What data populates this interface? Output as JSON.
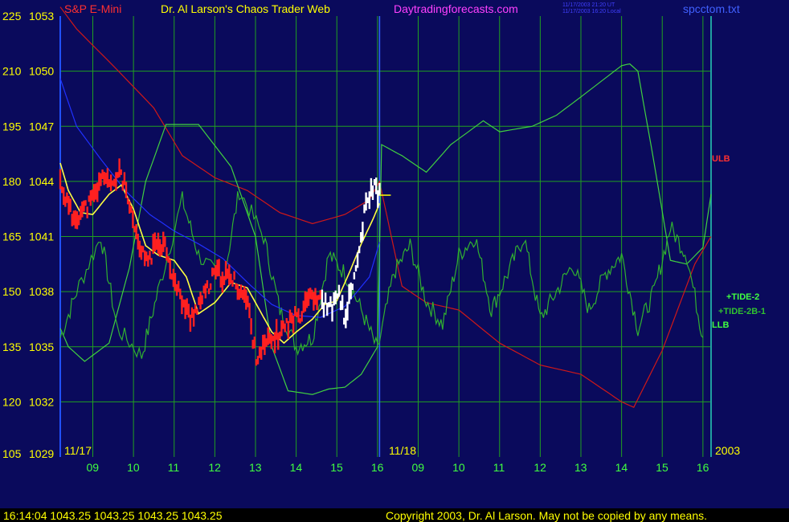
{
  "header": {
    "title": "S&P E-Mini",
    "subtitle": "Dr. Al Larson's Chaos Trader Web",
    "website": "Daytradingforecasts.com",
    "timestamp_ut": "11/17/2003 21:20 UT",
    "timestamp_local": "11/17/2003 16:20 Local",
    "filename": "spcctom.txt"
  },
  "footer": {
    "readout": "16:14:04  1043.25  1043.25  1043.25  1043.25",
    "copyright": "Copyright 2003, Dr. Al Larson. May not be copied by any means."
  },
  "colors": {
    "background": "#0a0a5c",
    "grid": "#20a020",
    "price_down": "#ff2020",
    "price_up": "#ffffff",
    "ulb_line": "#d01818",
    "llb_line": "#40d040",
    "tide_line": "#30b030",
    "moving_avg": "#ffff40",
    "blue_line": "#2030ff",
    "axis_labels": "#ffff00",
    "time_labels": "#40ff40"
  },
  "chart_data": {
    "type": "line",
    "title": "S&P E-Mini",
    "left_axis_ticks": [
      225,
      210,
      195,
      180,
      165,
      150,
      135,
      120,
      105
    ],
    "price_ticks": [
      1053,
      1050,
      1047,
      1044,
      1041,
      1038,
      1035,
      1032,
      1029
    ],
    "ylim": [
      1029,
      1053
    ],
    "hour_ticks": [
      "09",
      "10",
      "11",
      "12",
      "13",
      "14",
      "15",
      "16",
      "09",
      "10",
      "11",
      "12",
      "13",
      "14",
      "15",
      "16"
    ],
    "xlim": [
      8.2,
      24.2
    ],
    "date_markers": [
      "11/17",
      "11/18"
    ],
    "year": "2003",
    "current_price": 1043.25,
    "line_labels": {
      "ulb": "ULB",
      "tide_2": "+TIDE-2",
      "tide_2b_1": "+TIDE-2B-1",
      "llb": "LLB"
    },
    "series": [
      {
        "key": "ulb",
        "name": "ULB",
        "color": "#d01818",
        "x": [
          8.2,
          8.6,
          9.5,
          10.5,
          11.2,
          12.0,
          12.8,
          13.6,
          14.4,
          15.2,
          15.8,
          16.05,
          16.6,
          17.2,
          18.0,
          19.0,
          20.0,
          21.0,
          22.0,
          22.3,
          23.0,
          23.8,
          24.2
        ],
        "y": [
          1053.5,
          1052.3,
          1050.3,
          1048.0,
          1045.4,
          1044.2,
          1043.5,
          1042.3,
          1041.7,
          1042.2,
          1043.0,
          1044.0,
          1038.3,
          1037.4,
          1037.0,
          1035.2,
          1034.0,
          1033.5,
          1032.0,
          1031.7,
          1034.8,
          1039.5,
          1041.0
        ]
      },
      {
        "key": "llb",
        "name": "LLB",
        "color": "#40d040",
        "x": [
          8.2,
          8.4,
          8.8,
          9.4,
          9.9,
          10.3,
          10.8,
          11.6,
          12.4,
          13.0,
          13.4,
          13.8,
          14.4,
          14.8,
          15.2,
          15.6,
          16.0,
          16.1,
          16.6,
          17.2,
          17.8,
          18.6,
          19.0,
          19.8,
          20.4,
          21.0,
          22.0,
          22.2,
          22.4,
          22.8,
          23.2,
          23.6,
          24.0,
          24.2
        ],
        "y": [
          1036.0,
          1035.0,
          1034.2,
          1035.2,
          1039.3,
          1044.0,
          1047.1,
          1047.1,
          1044.8,
          1041.0,
          1035.0,
          1032.6,
          1032.4,
          1032.7,
          1032.8,
          1033.5,
          1035.0,
          1046.0,
          1045.4,
          1044.5,
          1046.0,
          1047.3,
          1046.7,
          1047.0,
          1047.6,
          1048.6,
          1050.3,
          1050.4,
          1050.0,
          1045.0,
          1039.7,
          1039.5,
          1040.4,
          1043.3
        ]
      },
      {
        "key": "tide2",
        "name": "+TIDE-2",
        "color": "#30b030",
        "noise": 0.25,
        "x": [
          8.2,
          8.6,
          9.2,
          9.6,
          10.2,
          10.6,
          11.2,
          11.6,
          12.2,
          12.6,
          13.2,
          13.6,
          14.0,
          14.4,
          14.8,
          15.2,
          15.6,
          16.0,
          16.4,
          16.8,
          17.2,
          17.6,
          18.0,
          18.4,
          18.8,
          19.2,
          19.6,
          20.0,
          20.4,
          20.8,
          21.2,
          21.6,
          22.0,
          22.4,
          22.8,
          23.2,
          23.6,
          24.0
        ],
        "y": [
          1035.5,
          1038.0,
          1041.0,
          1036.0,
          1034.5,
          1038.0,
          1043.0,
          1040.0,
          1038.5,
          1043.5,
          1041.0,
          1037.0,
          1035.0,
          1035.5,
          1040.0,
          1039.0,
          1037.0,
          1034.8,
          1039.0,
          1040.5,
          1037.5,
          1036.2,
          1040.0,
          1041.0,
          1037.0,
          1039.0,
          1041.0,
          1036.5,
          1038.0,
          1039.5,
          1037.0,
          1039.0,
          1040.0,
          1036.0,
          1038.0,
          1041.5,
          1040.0,
          1035.5
        ]
      },
      {
        "key": "blue",
        "name": "",
        "color": "#2030ff",
        "x": [
          8.2,
          8.6,
          9.2,
          9.8,
          10.4,
          11.0,
          11.6,
          12.2,
          12.8,
          13.4,
          14.0,
          14.6,
          15.2,
          15.8,
          16.05
        ],
        "y": [
          1049.6,
          1047.0,
          1045.2,
          1043.5,
          1042.2,
          1041.3,
          1040.6,
          1039.8,
          1038.5,
          1037.3,
          1036.7,
          1036.6,
          1037.2,
          1038.8,
          1040.7
        ]
      },
      {
        "key": "ma",
        "name": "",
        "color": "#ffff40",
        "x": [
          8.2,
          8.4,
          8.7,
          9.0,
          9.4,
          9.7,
          10.0,
          10.3,
          10.6,
          11.0,
          11.3,
          11.6,
          12.0,
          12.4,
          12.8,
          13.1,
          13.4,
          13.7,
          14.0,
          14.4,
          14.7,
          15.0,
          15.3,
          15.6,
          15.9,
          16.05
        ],
        "y": [
          1045.0,
          1043.5,
          1042.3,
          1042.2,
          1043.3,
          1043.8,
          1042.5,
          1040.5,
          1040.0,
          1039.7,
          1038.8,
          1036.8,
          1037.4,
          1038.5,
          1038.2,
          1037.0,
          1035.8,
          1035.2,
          1035.8,
          1036.5,
          1037.3,
          1037.5,
          1039.0,
          1040.6,
          1042.0,
          1042.8
        ]
      }
    ],
    "price_bars": {
      "x_start": 8.2,
      "x_end": 16.05,
      "spread": 0.9,
      "up_color": "#ffffff",
      "down_color": "#ff2020",
      "path_x": [
        8.2,
        8.3,
        8.5,
        8.8,
        9.0,
        9.3,
        9.5,
        9.65,
        9.8,
        10.0,
        10.2,
        10.4,
        10.6,
        10.8,
        11.0,
        11.2,
        11.4,
        11.5,
        11.8,
        12.0,
        12.3,
        12.5,
        12.8,
        13.0,
        13.3,
        13.5,
        13.8,
        14.1,
        14.3,
        14.6,
        14.9,
        15.0,
        15.2,
        15.5,
        15.7,
        15.9,
        16.05
      ],
      "path_y": [
        1044.0,
        1043.3,
        1042.0,
        1042.5,
        1043.0,
        1044.5,
        1043.5,
        1044.8,
        1043.6,
        1041.5,
        1040.0,
        1039.8,
        1040.8,
        1040.5,
        1038.5,
        1037.5,
        1036.5,
        1037.0,
        1038.0,
        1039.0,
        1038.8,
        1038.5,
        1037.5,
        1034.5,
        1035.2,
        1035.5,
        1036.3,
        1036.8,
        1038.0,
        1037.5,
        1037.0,
        1038.2,
        1036.5,
        1039.5,
        1042.5,
        1043.8,
        1043.25
      ],
      "white_from": 14.6
    },
    "last_price_marker": {
      "x": 16.05,
      "y": 1043.25,
      "color": "#ffff00"
    }
  }
}
